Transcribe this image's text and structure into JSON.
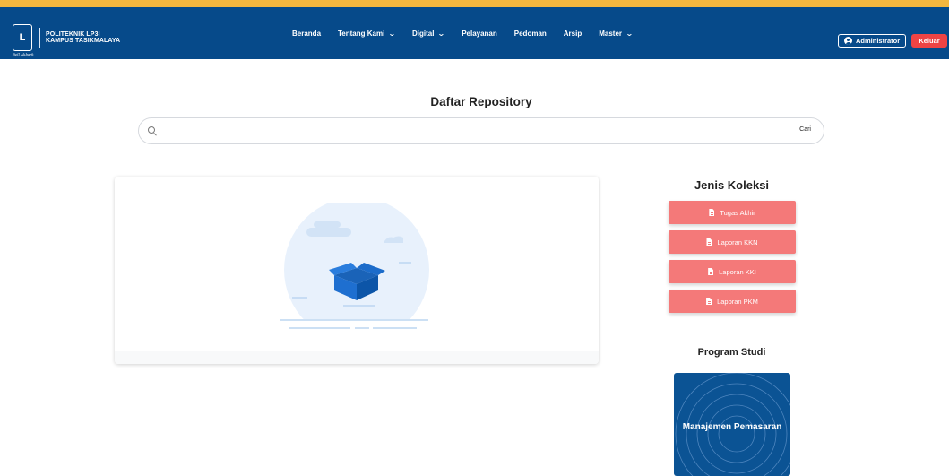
{
  "brand": {
    "line1": "POLITEKNIK LP3I",
    "line2": "KAMPUS TASIKMALAYA",
    "tagline": "Bell Akbark"
  },
  "nav": {
    "items": [
      {
        "label": "Beranda",
        "has_dropdown": false
      },
      {
        "label": "Tentang Kami",
        "has_dropdown": true
      },
      {
        "label": "Digital",
        "has_dropdown": true
      },
      {
        "label": "Pelayanan",
        "has_dropdown": false
      },
      {
        "label": "Pedoman",
        "has_dropdown": false
      },
      {
        "label": "Arsip",
        "has_dropdown": false
      },
      {
        "label": "Master",
        "has_dropdown": true
      }
    ],
    "chevron": "⌄"
  },
  "user": {
    "admin_label": "Administrator",
    "logout_label": "Keluar"
  },
  "page": {
    "title": "Daftar Repository"
  },
  "search": {
    "placeholder": "",
    "value": "",
    "button_label": "Cari",
    "icon": "search-icon"
  },
  "sidebar": {
    "koleksi_title": "Jenis Koleksi",
    "koleksi": [
      {
        "label": "Tugas Akhir",
        "icon": "file-icon"
      },
      {
        "label": "Laporan KKN",
        "icon": "file-icon"
      },
      {
        "label": "Laporan KKI",
        "icon": "file-icon"
      },
      {
        "label": "Laporan PKM",
        "icon": "file-icon"
      }
    ],
    "prodi_title": "Program Studi",
    "prodi": [
      {
        "label": "Manajemen Pemasaran"
      }
    ]
  },
  "colors": {
    "navbar": "#064a8a",
    "accent_strip": "#f4b73f",
    "logout": "#ef4444",
    "koleksi_button": "#f47979",
    "prodi_card": "#0b5394"
  }
}
